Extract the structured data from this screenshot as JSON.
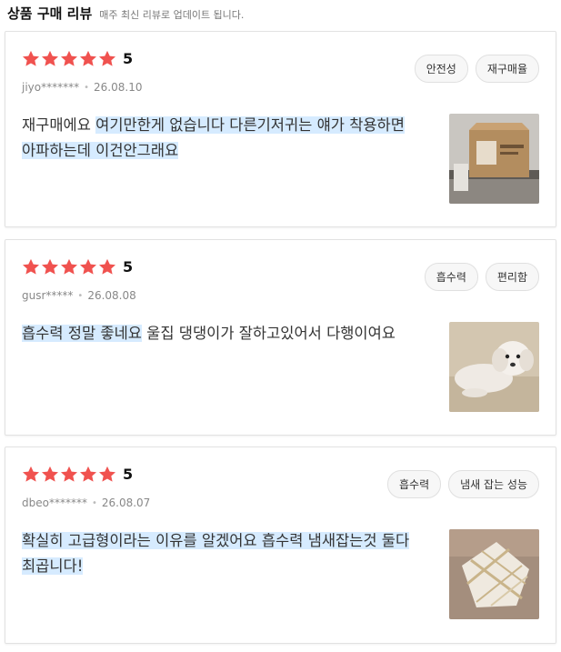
{
  "header": {
    "title": "상품 구매 리뷰",
    "subtitle": "매주 최신 리뷰로 업데이트 됩니다."
  },
  "reviews": [
    {
      "rating": 5,
      "score_text": "5",
      "user": "jiyo*******",
      "date": "26.08.10",
      "tags": [
        "안전성",
        "재구매율"
      ],
      "text_plain_1": "재구매에요 ",
      "text_highlight": "여기만한게 없습니다 다른기저귀는 얘가 착용하면 아파하는데 이건안그래요",
      "text_plain_2": "",
      "image_icon": "product-box-photo"
    },
    {
      "rating": 5,
      "score_text": "5",
      "user": "gusr*****",
      "date": "26.08.08",
      "tags": [
        "흡수력",
        "편리함"
      ],
      "text_plain_1": "",
      "text_highlight": "흡수력 정말 좋네요",
      "text_plain_2": " 울집 댕댕이가 잘하고있어서 다행이여요",
      "image_icon": "white-dog-photo"
    },
    {
      "rating": 5,
      "score_text": "5",
      "user": "dbeo*******",
      "date": "26.08.07",
      "tags": [
        "흡수력",
        "냄새 잡는 성능"
      ],
      "text_plain_1": "",
      "text_highlight": "확실히 고급형이라는 이유를 알겠어요 흡수력 냄새잡는것 둘다 최곱니다!",
      "text_plain_2": "",
      "image_icon": "folded-pad-photo"
    }
  ],
  "colors": {
    "star": "#f0524f",
    "highlight": "#d6ebff"
  }
}
